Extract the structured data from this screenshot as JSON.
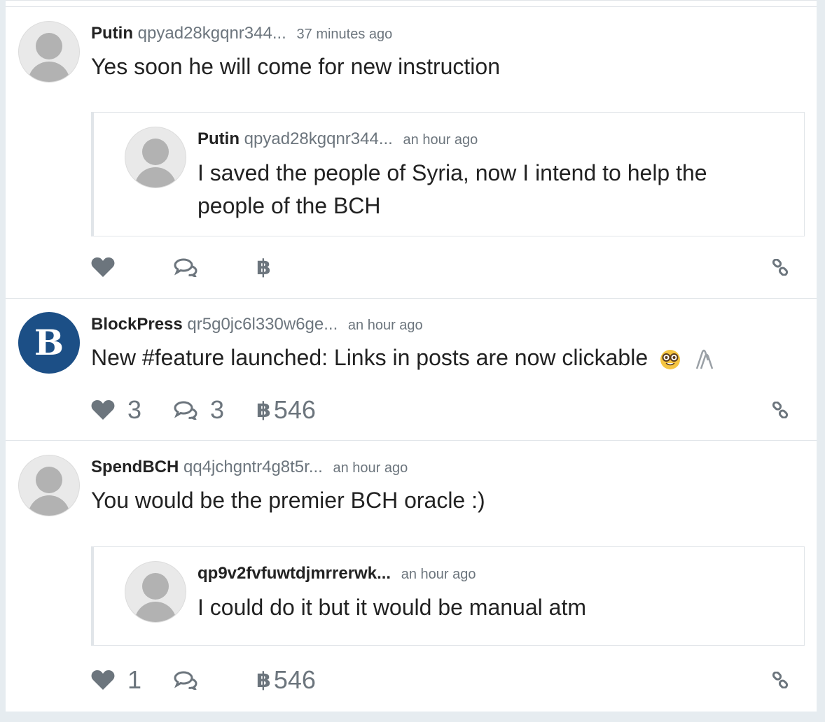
{
  "posts": [
    {
      "name": "Putin",
      "address": "qpyad28kgqnr344...",
      "time": "37 minutes ago",
      "text": "Yes soon he will come for new instruction",
      "quote": {
        "name": "Putin",
        "address": "qpyad28kgqnr344...",
        "time": "an hour ago",
        "text": "I saved the people of Syria, now I intend to help the people of the BCH"
      },
      "actions": {
        "likes": "",
        "replies": "",
        "tips": ""
      }
    },
    {
      "name": "BlockPress",
      "address": "qr5g0jc6l330w6ge...",
      "time": "an hour ago",
      "text": "New #feature launched: Links in posts are now clickable",
      "avatar_letter": "B",
      "actions": {
        "likes": "3",
        "replies": "3",
        "tips": "546"
      }
    },
    {
      "name": "SpendBCH",
      "address": "qq4jchgntr4g8t5r...",
      "time": "an hour ago",
      "text": "You would be the premier BCH oracle :)",
      "quote": {
        "name": "qp9v2fvfuwtdjmrrerwk...",
        "address": "",
        "time": "an hour ago",
        "text": "I could do it but it would be manual atm"
      },
      "actions": {
        "likes": "1",
        "replies": "",
        "tips": "546"
      }
    }
  ],
  "icons": {
    "like": "heart-icon",
    "reply": "comments-icon",
    "tip": "bitcoin-icon",
    "link": "link-icon",
    "emoji_1": "nerd-face-emoji",
    "emoji_2": "paperclips-emoji"
  },
  "colors": {
    "icon": "#6c757d",
    "brand_avatar": "#1c4f86",
    "background": "#e6ecf0"
  },
  "btc_symbol": "฿"
}
